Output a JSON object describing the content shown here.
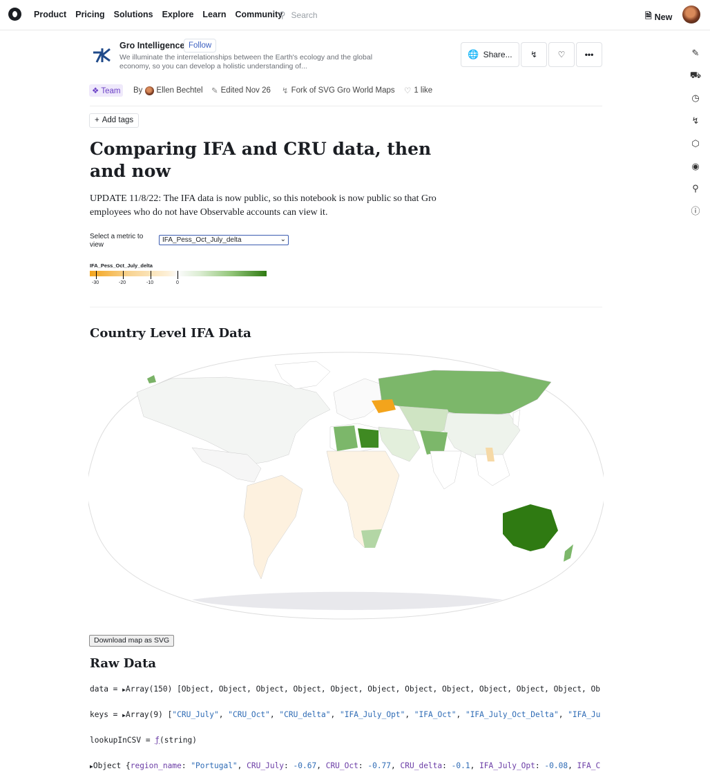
{
  "nav": {
    "links": [
      "Product",
      "Pricing",
      "Solutions",
      "Explore",
      "Learn",
      "Community"
    ],
    "search_placeholder": "Search",
    "new_label": "New"
  },
  "header": {
    "org_name": "Gro Intelligence",
    "follow_label": "Follow",
    "org_description": "We illuminate the interrelationships between the Earth's ecology and the global economy, so you can develop a holistic understanding of...",
    "share_label": "Share..."
  },
  "meta": {
    "team_label": "Team",
    "by_label": "By",
    "author": "Ellen Bechtel",
    "edited": "Edited Nov 26",
    "fork": "Fork of SVG Gro World Maps",
    "likes": "1 like"
  },
  "add_tags_label": "Add tags",
  "notebook": {
    "title": "Comparing IFA and CRU data, then and now",
    "update_text": "UPDATE 11/8/22: The IFA data is now public, so this notebook is now public so that Gro employees who do not have Observable accounts can view it.",
    "select_label": "Select a metric to view",
    "select_value": "IFA_Pess_Oct_July_delta"
  },
  "legend": {
    "title": "IFA_Pess_Oct_July_delta",
    "ticks": [
      "-30",
      "-20",
      "-10",
      "0"
    ],
    "colors": {
      "negative": "#f3a41c",
      "neutral": "#fbfbfb",
      "positive": "#2f7a12"
    }
  },
  "sections": {
    "map_heading": "Country Level IFA Data",
    "download_label": "Download map as SVG",
    "raw_heading": "Raw Data"
  },
  "code": {
    "data_prefix": "data = ",
    "data_summary": "Array(150) [Object, Object, Object, Object, Object, Object, Object, Object, Object, Object, Object, Ob",
    "keys_prefix": "keys = ",
    "keys_array": "Array(9)",
    "keys_values": [
      "CRU_July",
      "CRU_Oct",
      "CRU_delta",
      "IFA_July_Opt",
      "IFA_Oct",
      "IFA_July_Oct_Delta",
      "IFA_Ju"
    ],
    "lookup_prefix": "lookupInCSV = ",
    "lookup_fn": "ƒ",
    "lookup_args": "(string)",
    "object_label": "Object",
    "object_region_value": "\"Portugal\"",
    "object_fields": [
      {
        "key": "region_name",
        "value": "\"Portugal\""
      },
      {
        "key": "CRU_July",
        "value": "-0.67"
      },
      {
        "key": "CRU_Oct",
        "value": "-0.77"
      },
      {
        "key": "CRU_delta",
        "value": "-0.1"
      },
      {
        "key": "IFA_July_Opt",
        "value": "-0.08"
      },
      {
        "key": "IFA_C",
        "value": ""
      }
    ]
  }
}
